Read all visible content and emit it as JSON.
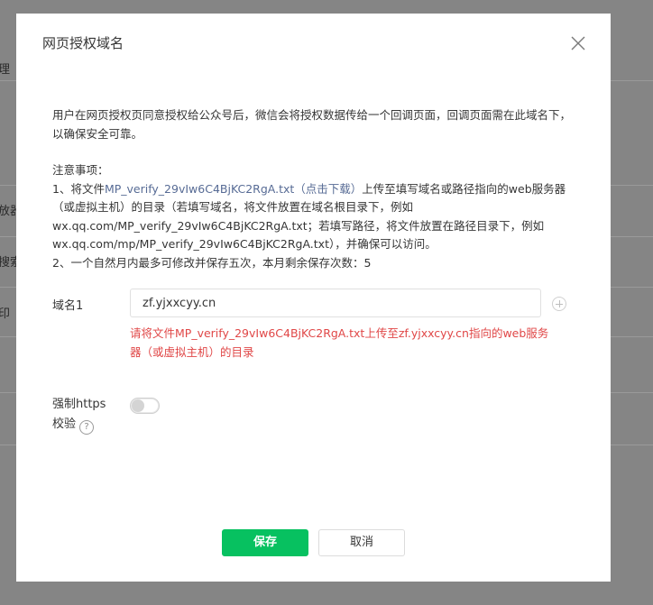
{
  "background": {
    "fragments": [
      "理",
      "放器",
      "搜索",
      "印"
    ]
  },
  "dialog": {
    "title": "网页授权域名",
    "description": "用户在网页授权页同意授权给公众号后，微信会将授权数据传给一个回调页面，回调页面需在此域名下，以确保安全可靠。",
    "notes": {
      "heading": "注意事项：",
      "line1_prefix": "1、将文件",
      "file_name": "MP_verify_29vIw6C4BjKC2RgA.txt",
      "download_link": "（点击下载）",
      "line1_suffix": "上传至填写域名或路径指向的web服务器",
      "line2": "（或虚拟主机）的目录（若填写域名，将文件放置在域名根目录下，例如",
      "line3": "wx.qq.com/MP_verify_29vIw6C4BjKC2RgA.txt；若填写路径，将文件放置在路径目录下，例如",
      "line4": "wx.qq.com/mp/MP_verify_29vIw6C4BjKC2RgA.txt），并确保可以访问。",
      "line5": "2、一个自然月内最多可修改并保存五次，本月剩余保存次数：5"
    },
    "domain": {
      "label": "域名1",
      "value": "zf.yjxxcyy.cn",
      "error": "请将文件MP_verify_29vIw6C4BjKC2RgA.txt上传至zf.yjxxcyy.cn指向的web服务器（或虚拟主机）的目录"
    },
    "https": {
      "label_line1": "强制https",
      "label_line2": "校验",
      "help": "?",
      "enabled": false
    },
    "buttons": {
      "save": "保存",
      "cancel": "取消"
    },
    "colors": {
      "primary": "#07c160",
      "error": "#e04747",
      "link": "#576b95"
    }
  }
}
